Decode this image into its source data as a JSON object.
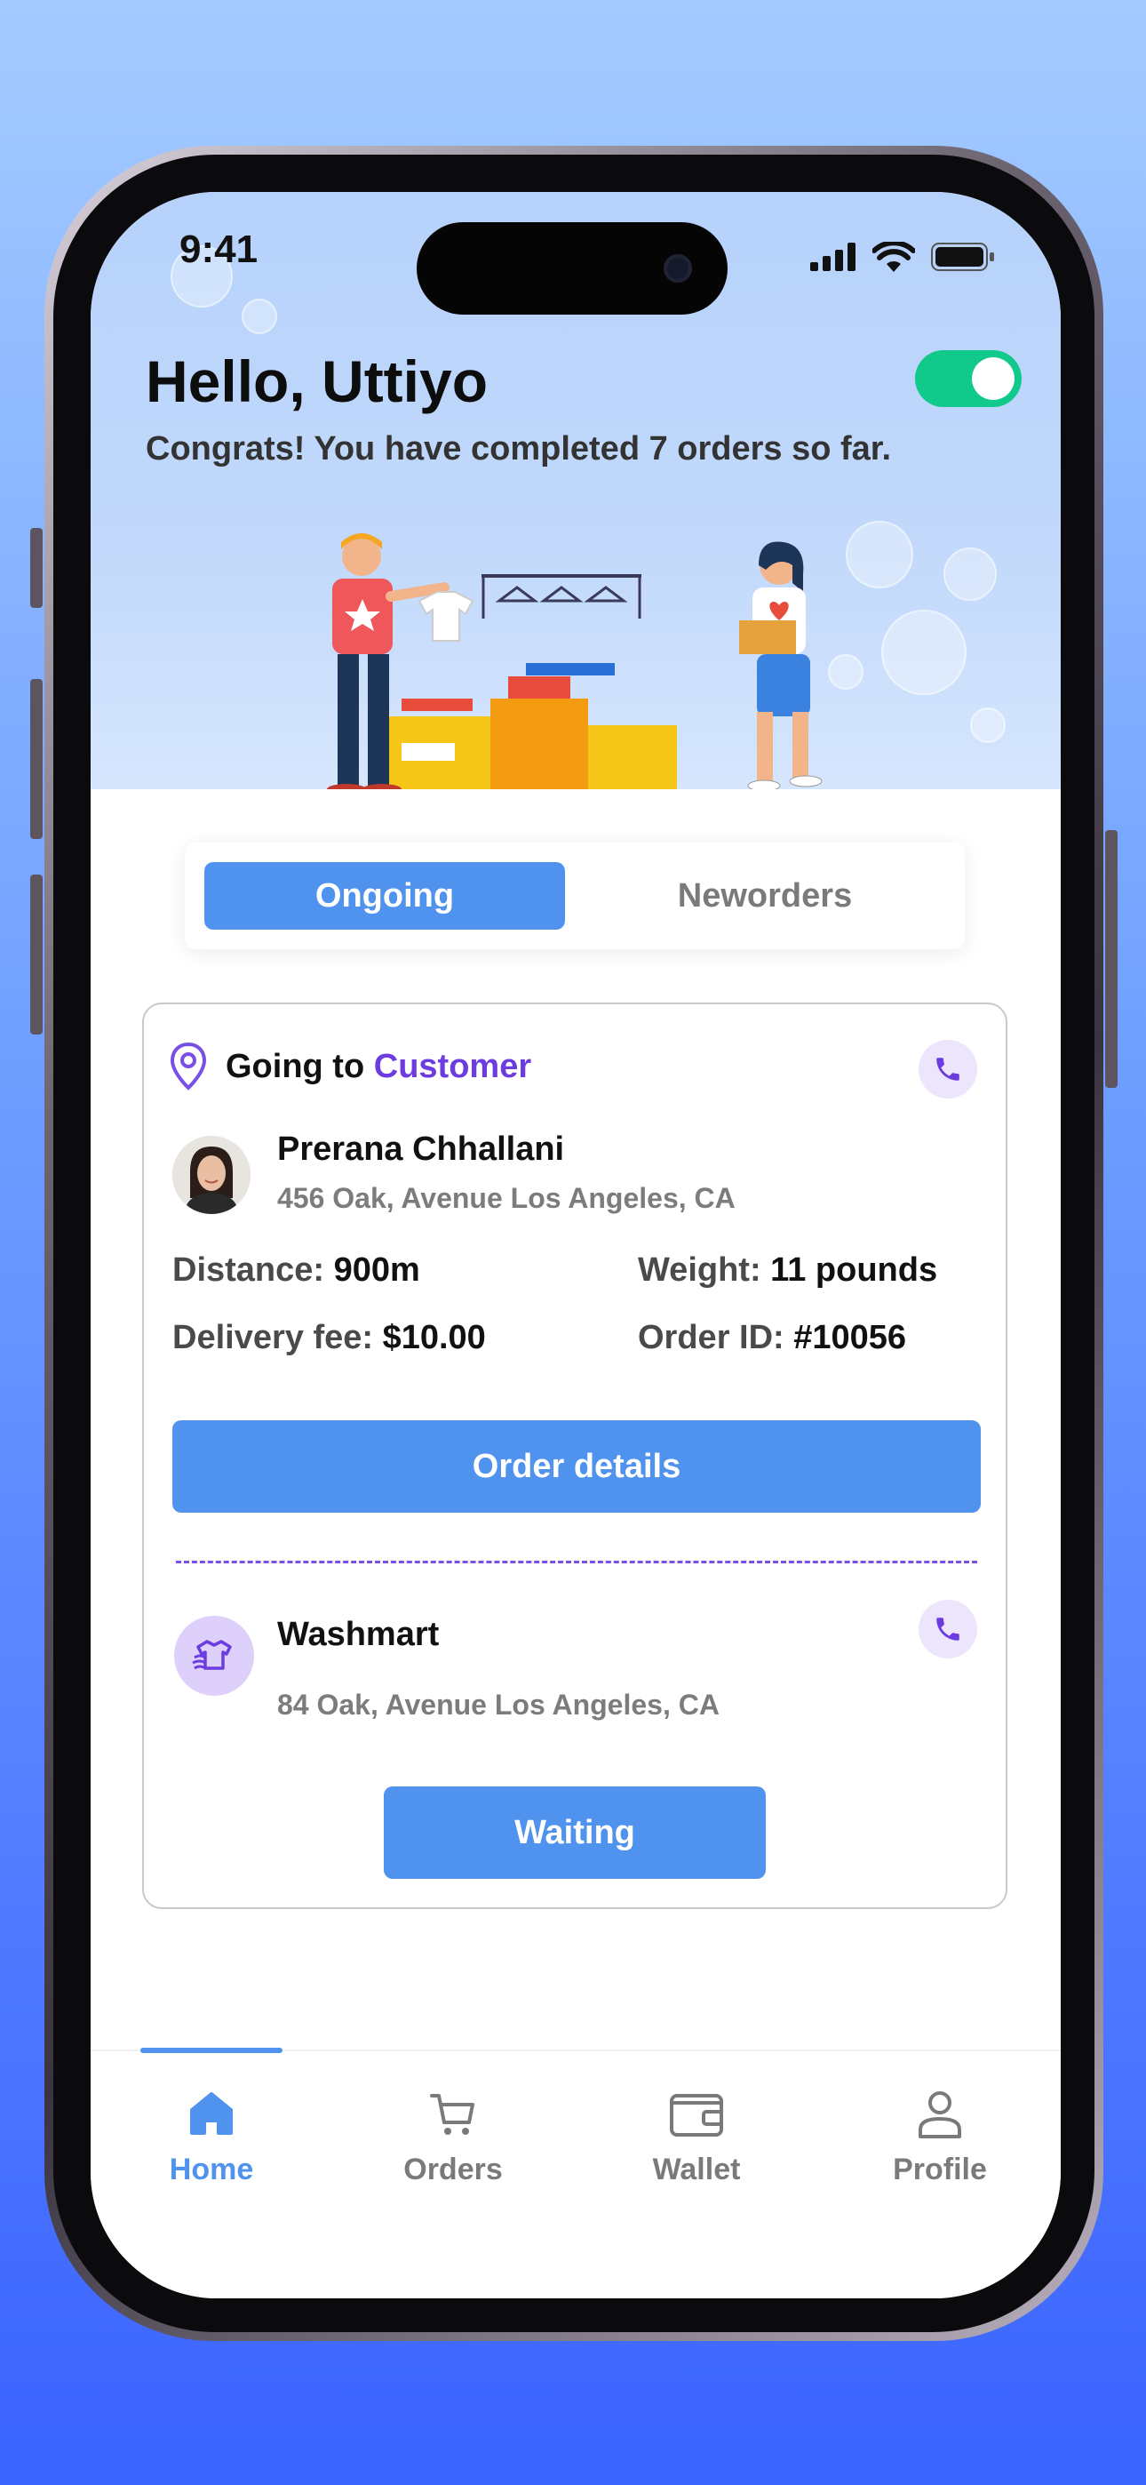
{
  "status_bar": {
    "time": "9:41"
  },
  "header": {
    "greeting": "Hello, Uttiyo",
    "congrats": "Congrats! You have completed 7 orders so far.",
    "online_toggle": true
  },
  "tabs": [
    {
      "label": "Ongoing",
      "active": true
    },
    {
      "label": "Neworders",
      "active": false
    }
  ],
  "order": {
    "going_to_prefix": "Going to",
    "going_to_target": "Customer",
    "customer_name": "Prerana Chhallani",
    "customer_address": "456 Oak, Avenue Los Angeles, CA",
    "distance_label": "Distance:",
    "distance_value": "900m",
    "weight_label": "Weight:",
    "weight_value": "11 pounds",
    "fee_label": "Delivery fee:",
    "fee_value": "$10.00",
    "order_id_label": "Order ID:",
    "order_id_value": "#10056",
    "details_button": "Order details",
    "shop_name": "Washmart",
    "shop_address": "84 Oak, Avenue Los Angeles, CA",
    "status_button": "Waiting"
  },
  "nav": [
    {
      "label": "Home",
      "icon": "home-icon",
      "active": true
    },
    {
      "label": "Orders",
      "icon": "cart-icon",
      "active": false
    },
    {
      "label": "Wallet",
      "icon": "wallet-icon",
      "active": false
    },
    {
      "label": "Profile",
      "icon": "profile-icon",
      "active": false
    }
  ],
  "colors": {
    "accent": "#4f93ee",
    "purple": "#6c3ce0",
    "toggle_on": "#11c98a"
  }
}
